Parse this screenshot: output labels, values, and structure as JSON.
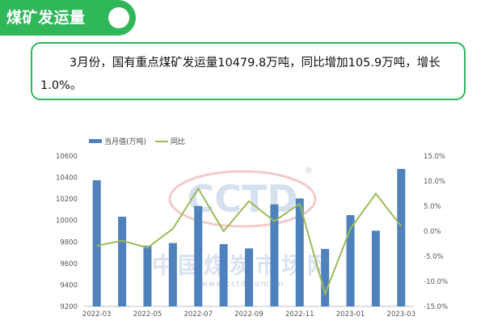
{
  "header": {
    "title": "煤矿发运量"
  },
  "summary": {
    "text": "3月份，国有重点煤矿发运量10479.8万吨，同比增加105.9万吨，增长1.0%。"
  },
  "watermark": {
    "logo": "CCTD",
    "registered": "®",
    "cn": "中国煤炭市场网",
    "url": "www.cctd.com.cn"
  },
  "colors": {
    "accent": "#2fb75a",
    "bar": "#4f81bd",
    "line": "#9bbb59"
  },
  "chart_data": {
    "type": "bar",
    "categories": [
      "2022-03",
      "2022-04",
      "2022-05",
      "2022-06",
      "2022-07",
      "2022-08",
      "2022-09",
      "2022-10",
      "2022-11",
      "2022-12",
      "2023-01",
      "2023-02",
      "2023-03"
    ],
    "x_tick_labels": [
      "2022-03",
      "2022-05",
      "2022-07",
      "2022-09",
      "2022-11",
      "2023-01",
      "2023-03"
    ],
    "series": [
      {
        "name": "当月值(万吨)",
        "type": "bar",
        "axis": "left",
        "values": [
          10375,
          10035,
          9765,
          9790,
          10135,
          9780,
          9740,
          10150,
          10205,
          9735,
          10050,
          9905,
          10480
        ]
      },
      {
        "name": "同比",
        "type": "line",
        "axis": "right",
        "values": [
          -2.9,
          -1.9,
          -3.3,
          0.5,
          8.5,
          0.0,
          6.0,
          2.0,
          5.5,
          -12.5,
          0.5,
          7.5,
          1.0
        ]
      }
    ],
    "y_left": {
      "min": 9200,
      "max": 10600,
      "ticks": [
        "9200",
        "9400",
        "9600",
        "9800",
        "10000",
        "10200",
        "10400",
        "10600"
      ]
    },
    "y_right": {
      "min": -15,
      "max": 15,
      "ticks": [
        "-15.0%",
        "-10.0%",
        "-5.0%",
        "0.0%",
        "5.0%",
        "10.0%",
        "15.0%"
      ]
    },
    "legend_position": "top-left",
    "grid": false
  }
}
